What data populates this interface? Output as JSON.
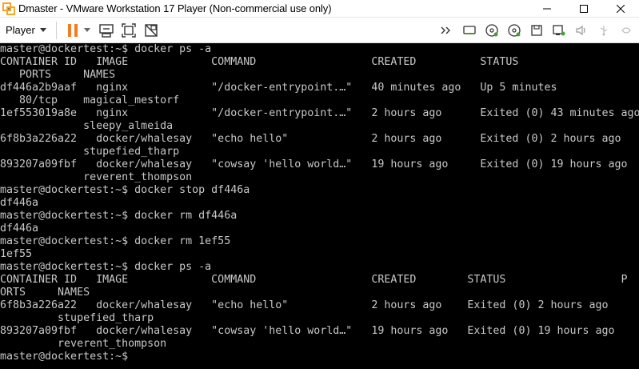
{
  "window": {
    "title": "Dmaster - VMware Workstation 17 Player (Non-commercial use only)"
  },
  "toolbar": {
    "player_label": "Player",
    "icons": [
      "pause-icon",
      "send-ctrl-alt-del-icon",
      "fit-guest-icon",
      "unity-icon",
      "forward-icon",
      "hdd-icon",
      "cd-icon",
      "cd2-icon",
      "floppy-icon",
      "network-icon",
      "sound-icon",
      "usb-icon",
      "more-devices-icon"
    ]
  },
  "colors": {
    "terminal_bg": "#000000",
    "terminal_fg": "#c8c8c8",
    "titlebar_bg": "#ffffff",
    "pause_orange": "#f47c20"
  },
  "terminal": {
    "lines": [
      "master@dockertest:~$ docker ps -a",
      "CONTAINER ID   IMAGE             COMMAND                  CREATED          STATUS",
      "   PORTS     NAMES",
      "df446a2b9aaf   nginx             \"/docker-entrypoint.…\"   40 minutes ago   Up 5 minutes",
      "   80/tcp    magical_mestorf",
      "1ef553019a8e   nginx             \"/docker-entrypoint.…\"   2 hours ago      Exited (0) 43 minutes ago",
      "             sleepy_almeida",
      "6f8b3a226a22   docker/whalesay   \"echo hello\"             2 hours ago      Exited (0) 2 hours ago",
      "             stupefied_tharp",
      "893207a09fbf   docker/whalesay   \"cowsay 'hello world…\"   19 hours ago     Exited (0) 19 hours ago",
      "             reverent_thompson",
      "master@dockertest:~$ docker stop df446a",
      "df446a",
      "master@dockertest:~$ docker rm df446a",
      "df446a",
      "master@dockertest:~$ docker rm 1ef55",
      "1ef55",
      "master@dockertest:~$ docker ps -a",
      "CONTAINER ID   IMAGE             COMMAND                  CREATED        STATUS                  P",
      "ORTS     NAMES",
      "6f8b3a226a22   docker/whalesay   \"echo hello\"             2 hours ago    Exited (0) 2 hours ago",
      "         stupefied_tharp",
      "893207a09fbf   docker/whalesay   \"cowsay 'hello world…\"   19 hours ago   Exited (0) 19 hours ago",
      "         reverent_thompson",
      "master@dockertest:~$ "
    ]
  }
}
